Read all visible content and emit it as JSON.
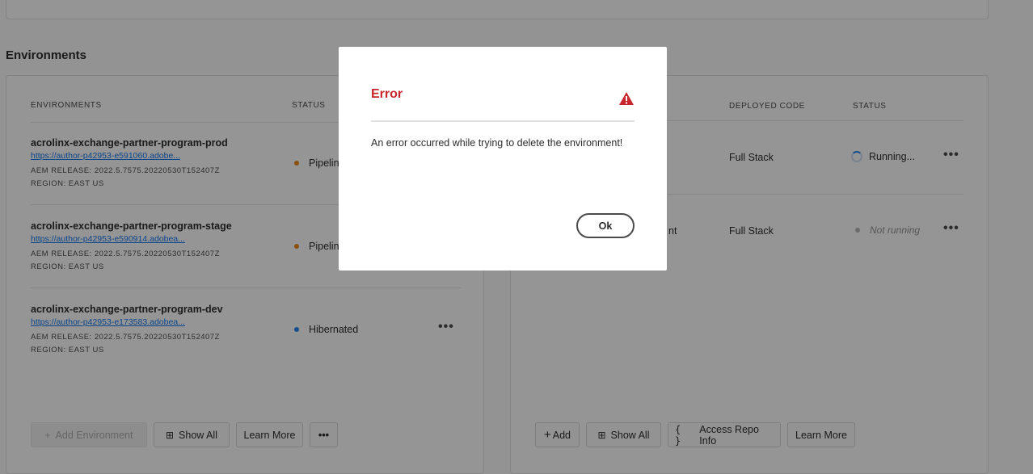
{
  "section_title": "Environments",
  "environments": {
    "headers": {
      "name": "ENVIRONMENTS",
      "status": "STATUS"
    },
    "rows": [
      {
        "name": "acrolinx-exchange-partner-program-prod",
        "url": "https://author-p42953-e591060.adobe...",
        "release": "AEM RELEASE: 2022.5.7575.20220530T152407Z",
        "region": "REGION: EAST US",
        "status": "Pipelin",
        "status_color": "#e68619"
      },
      {
        "name": "acrolinx-exchange-partner-program-stage",
        "url": "https://author-p42953-e590914.adobea...",
        "release": "AEM RELEASE: 2022.5.7575.20220530T152407Z",
        "region": "REGION: EAST US",
        "status": "Pipelin",
        "status_color": "#e68619"
      },
      {
        "name": "acrolinx-exchange-partner-program-dev",
        "url": "https://author-p42953-e173583.adobea...",
        "release": "AEM RELEASE: 2022.5.7575.20220530T152407Z",
        "region": "REGION: EAST US",
        "status": "Hibernated",
        "status_color": "#2680eb"
      }
    ],
    "more_label": "•••",
    "buttons": {
      "add": "Add Environment",
      "show_all": "Show All",
      "learn_more": "Learn More",
      "more": "•••"
    }
  },
  "pipelines": {
    "headers": {
      "deployed_code": "DEPLOYED CODE",
      "status": "STATUS"
    },
    "rows": [
      {
        "name_fragment": "",
        "deployed_code": "Full Stack",
        "status": "Running..."
      },
      {
        "name_fragment": "nt",
        "deployed_code": "Full Stack",
        "status": "Not running"
      }
    ],
    "more_label": "•••",
    "buttons": {
      "add": "Add",
      "show_all": "Show All",
      "access_repo": "Access Repo Info",
      "learn_more": "Learn More"
    }
  },
  "dialog": {
    "title": "Error",
    "message": "An error occurred while trying to delete the environment!",
    "ok_label": "Ok",
    "icon": "alert-triangle-icon",
    "title_color": "#c9252d"
  }
}
